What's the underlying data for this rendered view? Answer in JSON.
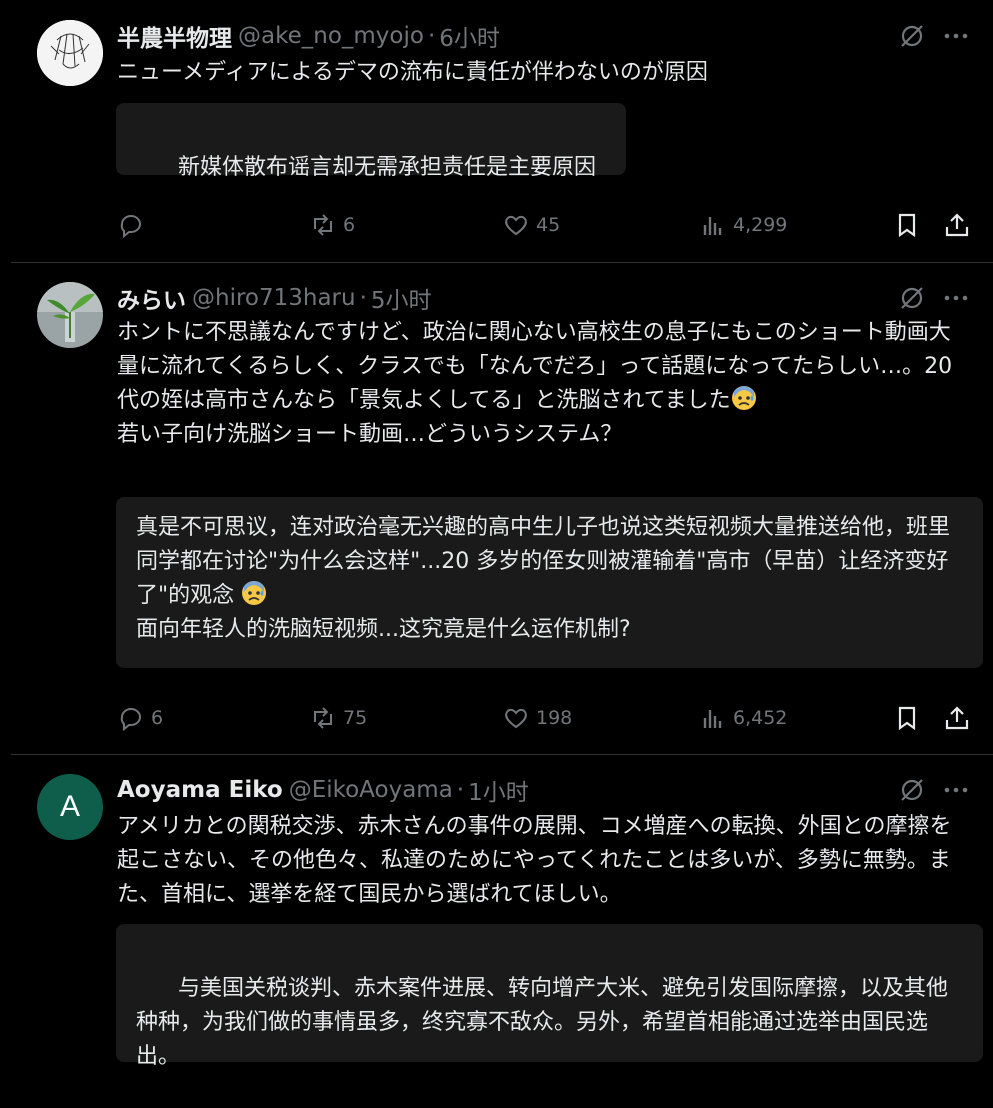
{
  "posts": [
    {
      "name": "半農半物理",
      "handle": "@ake_no_myojo",
      "dot": "·",
      "time": "6小时",
      "text": "ニューメディアによるデマの流布に責任が伴わないのが原因",
      "translation": "新媒体散布谣言却无需承担责任是主要原因",
      "replies": "",
      "reposts": "6",
      "likes": "45",
      "views": "4,299",
      "avatar_icon": "sketch-avatar"
    },
    {
      "name": "みらい",
      "handle": "@hiro713haru",
      "dot": "·",
      "time": "5小时",
      "text": "ホントに不思議なんですけど、政治に関心ない高校生の息子にもこのショート動画大量に流れてくるらしく、クラスでも「なんでだろ」って話題になってたらしい…。20代の姪は高市さんなら「景気よくしてる」と洗脳されてました",
      "text_line2": "若い子向け洗脳ショート動画…どういうシステム？",
      "translation": "真是不可思议，连对政治毫无兴趣的高中生儿子也说这类短视频大量推送给他，班里同学都在讨论\"为什么会这样\"...20 多岁的侄女则被灌输着\"高市（早苗）让经济变好了\"的观念",
      "translation_line2": "面向年轻人的洗脑短视频...这究竟是什么运作机制?",
      "replies": "6",
      "reposts": "75",
      "likes": "198",
      "views": "6,452",
      "avatar_icon": "plant-photo-avatar",
      "emoji_icon": "anxious-face-emoji"
    },
    {
      "name": "Aoyama Eiko",
      "handle": "@EikoAoyama",
      "dot": "·",
      "time": "1小时",
      "avatar_letter": "A",
      "text": "アメリカとの関税交渉、赤木さんの事件の展開、コメ増産への転換、外国との摩擦を起こさない、その他色々、私達のためにやってくれたことは多いが、多勢に無勢。また、首相に、選挙を経て国民から選ばれてほしい。",
      "translation": "与美国关税谈判、赤木案件进展、转向增产大米、避免引发国际摩擦，以及其他种种，为我们做的事情虽多，终究寡不敌众。另外，希望首相能通过选举由国民选出。",
      "avatar_color": "#0f5e4b"
    }
  ],
  "colors": {
    "muted": "#71767b",
    "divider": "#2f3336",
    "translation_bg": "#1a1a1a"
  }
}
